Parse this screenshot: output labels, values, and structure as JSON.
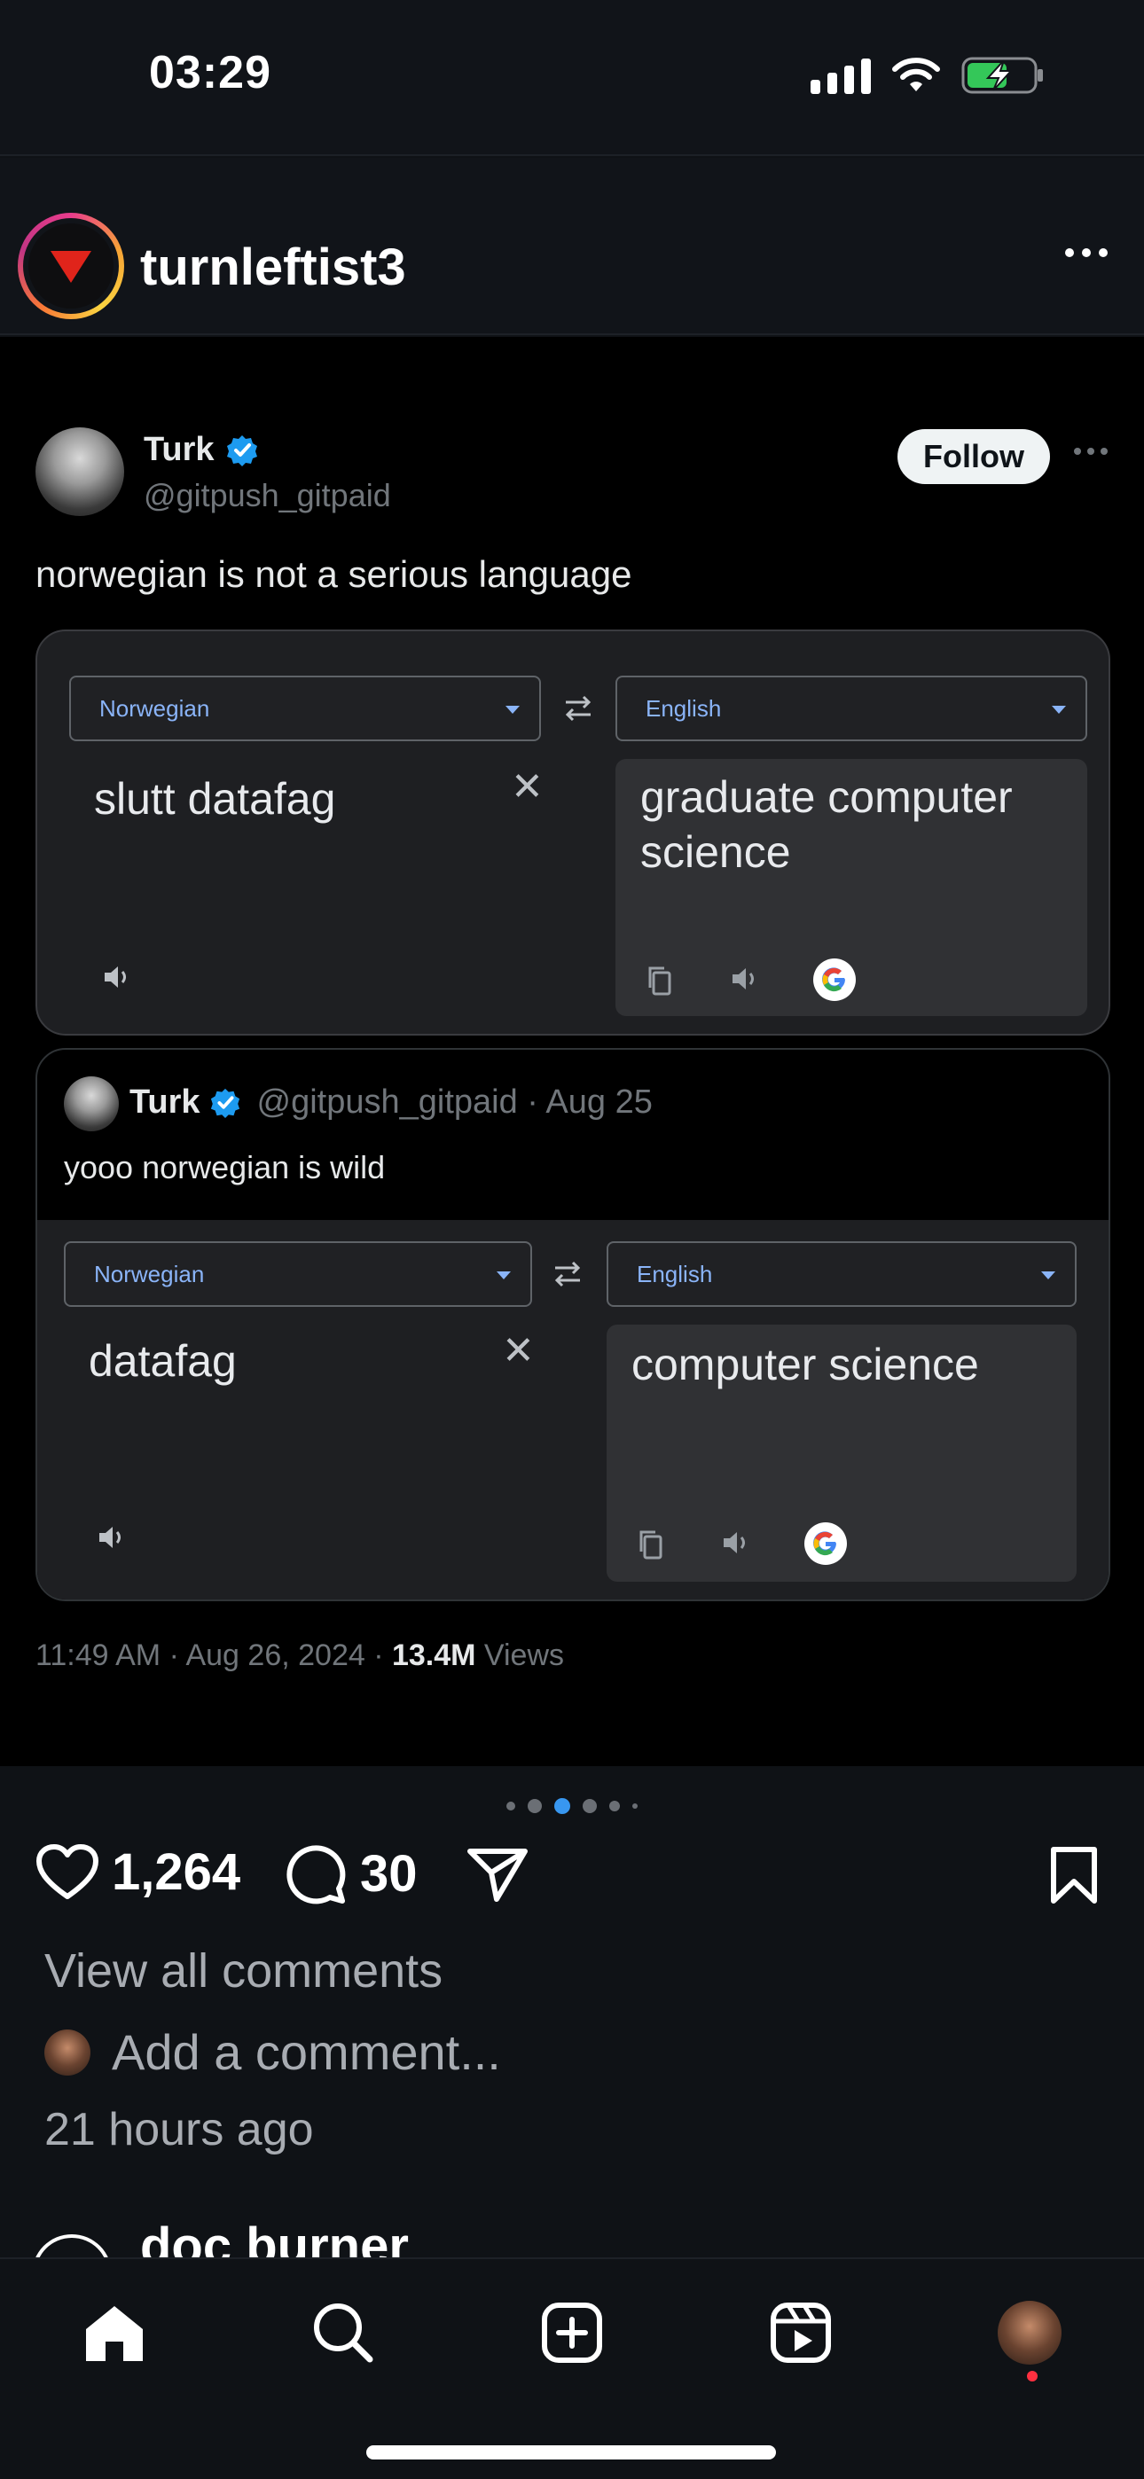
{
  "status_bar": {
    "time": "03:29"
  },
  "post": {
    "account_name": "turnleftist3"
  },
  "tweet": {
    "author_name": "Turk",
    "author_handle": "@gitpush_gitpaid",
    "follow_label": "Follow",
    "text": "norwegian is not a serious language",
    "translate": {
      "source_lang": "Norwegian",
      "target_lang": "English",
      "source_text": "slutt datafag",
      "target_text": "graduate computer science"
    },
    "quote": {
      "author_name": "Turk",
      "meta": "@gitpush_gitpaid · Aug 25",
      "text": "yooo norwegian is wild",
      "translate": {
        "source_lang": "Norwegian",
        "target_lang": "English",
        "source_text": "datafag",
        "target_text": "computer science"
      }
    },
    "timestamp": "11:49 AM · Aug 26, 2024 · ",
    "views_count": "13.4M",
    "views_label": " Views"
  },
  "actions": {
    "likes": "1,264",
    "comments": "30"
  },
  "comments": {
    "view_all": "View all comments",
    "add_placeholder": "Add a comment...",
    "time_ago": "21 hours ago"
  },
  "next_post": {
    "account_name": "doc burner"
  },
  "colors": {
    "background": "#0f1216",
    "accent_blue": "#3897f0",
    "verified": "#1d9bf0",
    "notification": "#ff3040"
  },
  "icons": [
    "heart-icon",
    "comment-icon",
    "share-icon",
    "bookmark-icon",
    "home-icon",
    "search-icon",
    "create-icon",
    "reels-icon"
  ]
}
